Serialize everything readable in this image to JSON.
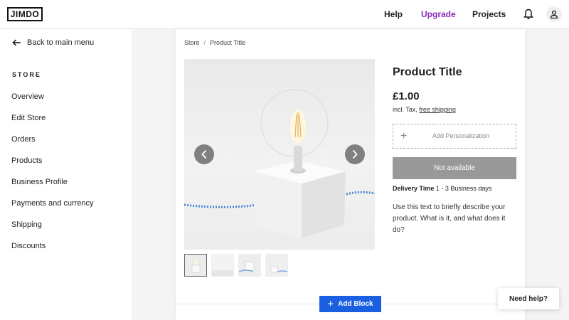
{
  "header": {
    "logo": "JIMDO",
    "nav": {
      "help": "Help",
      "upgrade": "Upgrade",
      "projects": "Projects"
    },
    "upgrade_color": "#8a2bb8"
  },
  "sidebar": {
    "back": "Back to main menu",
    "section": "STORE",
    "items": [
      "Overview",
      "Edit Store",
      "Orders",
      "Products",
      "Business Profile",
      "Payments and currency",
      "Shipping",
      "Discounts"
    ]
  },
  "breadcrumb": {
    "parent": "Store",
    "separator": "/",
    "current": "Product Title"
  },
  "product": {
    "title": "Product Title",
    "price": "£1.00",
    "tax_prefix": "incl. Tax,",
    "tax_link": "free shipping",
    "personalization": "Add Personalization",
    "status_button": "Not available",
    "delivery_label": "Delivery Time",
    "delivery_value": "1 - 3 Business days",
    "description": "Use this text to briefly describe your product. What is it, and what does it do?"
  },
  "gallery": {
    "thumbnail_count": 4,
    "active_index": 0
  },
  "actions": {
    "add_block": "Add Block",
    "need_help": "Need help?"
  },
  "colors": {
    "primary": "#1a5fe0",
    "disabled_button": "#999999"
  }
}
